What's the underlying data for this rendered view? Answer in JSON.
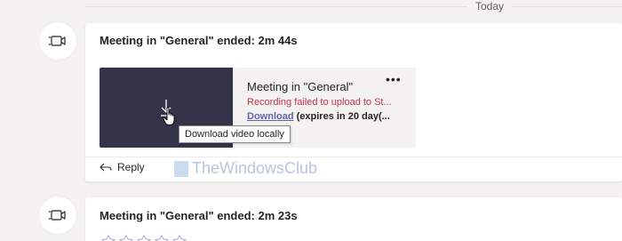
{
  "timeline": {
    "day_label": "Today"
  },
  "meetings": [
    {
      "title": "Meeting in \"General\" ended: 2m 44s",
      "recording": {
        "title": "Meeting in \"General\"",
        "error": "Recording failed to upload to St...",
        "download_label": "Download",
        "expires_label": "(expires in 20 day(...",
        "more_label": "•••",
        "tooltip": "Download video locally"
      },
      "reply_label": "Reply"
    },
    {
      "title": "Meeting in \"General\" ended: 2m 23s",
      "partial_text": " "
    }
  ],
  "watermark": {
    "text": "TheWindowsClub"
  },
  "icons": {
    "meeting": "video-camera-icon",
    "download": "download-arrow-icon",
    "reply": "reply-arrow-icon",
    "cursor": "hand-cursor-icon"
  },
  "colors": {
    "thumbnail": "#33344a",
    "error_text": "#c4314b",
    "link": "#6264a7",
    "background": "#f3f2f1"
  }
}
